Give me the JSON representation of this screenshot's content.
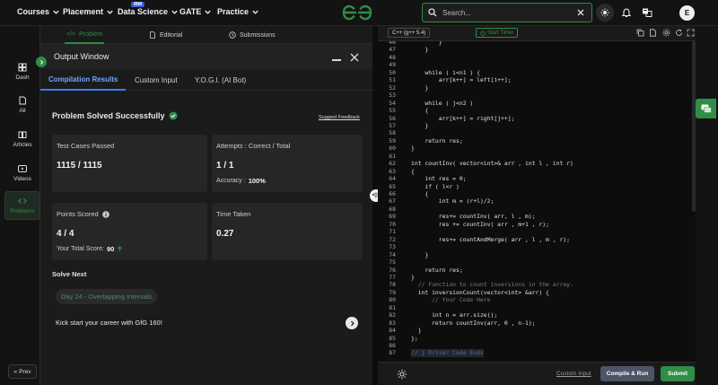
{
  "nav": {
    "items": [
      {
        "label": "Courses"
      },
      {
        "label": "Placement"
      },
      {
        "label": "Data Science"
      },
      {
        "label": "GATE"
      },
      {
        "label": "Practice"
      }
    ],
    "ibm_badge": "IBM",
    "search_placeholder": "Search...",
    "avatar_initial": "E"
  },
  "sidebar": {
    "items": [
      {
        "label": "Dash"
      },
      {
        "label": "All"
      },
      {
        "label": "Articles"
      },
      {
        "label": "Videos"
      },
      {
        "label": "Problems"
      }
    ],
    "prev_label": "Prev"
  },
  "problem_tabs": [
    {
      "label": "Problem"
    },
    {
      "label": "Editorial"
    },
    {
      "label": "Submissions"
    }
  ],
  "output": {
    "title": "Output Window",
    "tabs": [
      {
        "label": "Compilation Results"
      },
      {
        "label": "Custom Input"
      },
      {
        "label": "Y.O.G.I. (AI Bot)"
      }
    ],
    "status": "Problem Solved Successfully",
    "feedback": "Suggest Feedback",
    "cards": {
      "tests": {
        "label": "Test Cases Passed",
        "value": "1115 / 1115"
      },
      "attempts": {
        "label": "Attempts : Correct / Total",
        "value": "1 / 1",
        "sub_label": "Accuracy :",
        "sub_value": "100%"
      },
      "points": {
        "label": "Points Scored",
        "value": "4 / 4",
        "sub_label": "Your Total Score:",
        "sub_value": "90"
      },
      "time": {
        "label": "Time Taken",
        "value": "0.27"
      }
    },
    "solve_next": "Solve Next",
    "next_problem": "Day 24 - Overlapping Intervals",
    "kickstart": "Kick start your career with GfG 160!"
  },
  "editor": {
    "language": "C++ (g++ 5.4)",
    "timer": "Start Timer",
    "lines": [
      {
        "n": "46",
        "t": "        }"
      },
      {
        "n": "47",
        "t": "    }"
      },
      {
        "n": "48",
        "t": ""
      },
      {
        "n": "49",
        "t": ""
      },
      {
        "n": "50",
        "t": "    while ( i<n1 ) {"
      },
      {
        "n": "51",
        "t": "        arr[k++] = left[i++];"
      },
      {
        "n": "52",
        "t": "    }"
      },
      {
        "n": "53",
        "t": ""
      },
      {
        "n": "54",
        "t": "    while ( j<n2 )"
      },
      {
        "n": "55",
        "t": "    {"
      },
      {
        "n": "56",
        "t": "        arr[k++] = right[j++];"
      },
      {
        "n": "57",
        "t": "    }"
      },
      {
        "n": "58",
        "t": ""
      },
      {
        "n": "59",
        "t": "    return res;"
      },
      {
        "n": "60",
        "t": "}"
      },
      {
        "n": "61",
        "t": ""
      },
      {
        "n": "62",
        "t": "int countInv( vector<int>& arr , int l , int r)"
      },
      {
        "n": "63",
        "t": "{"
      },
      {
        "n": "64",
        "t": "    int res = 0;"
      },
      {
        "n": "65",
        "t": "    if ( l<r )"
      },
      {
        "n": "66",
        "t": "    {"
      },
      {
        "n": "67",
        "t": "        int m = (r+l)/2;"
      },
      {
        "n": "68",
        "t": ""
      },
      {
        "n": "69",
        "t": "        res+= countInv( arr, l , m);"
      },
      {
        "n": "70",
        "t": "        res += countInv( arr , m+1 , r);"
      },
      {
        "n": "71",
        "t": ""
      },
      {
        "n": "72",
        "t": "        res+= countAndMerge( arr , l , m , r);"
      },
      {
        "n": "73",
        "t": ""
      },
      {
        "n": "74",
        "t": "    }"
      },
      {
        "n": "75",
        "t": ""
      },
      {
        "n": "76",
        "t": "    return res;"
      },
      {
        "n": "77",
        "t": "}"
      },
      {
        "n": "78",
        "t": "  // Function to count inversions in the array."
      },
      {
        "n": "79",
        "t": "  int inversionCount(vector<int> &arr) {"
      },
      {
        "n": "80",
        "t": "      // Your Code Here"
      },
      {
        "n": "81",
        "t": ""
      },
      {
        "n": "82",
        "t": "      int n = arr.size();"
      },
      {
        "n": "83",
        "t": "      return countInv(arr, 0 , n-1);"
      },
      {
        "n": "84",
        "t": "  }"
      },
      {
        "n": "85",
        "t": "};"
      },
      {
        "n": "86",
        "t": ""
      },
      {
        "n": "87",
        "t": "// } Driver Code Ends"
      }
    ],
    "custom_input": "Custom Input",
    "compile": "Compile & Run",
    "submit": "Submit"
  },
  "colors": {
    "accent_green": "#2f8d46",
    "accent_blue": "#3b7bf0",
    "background": "#131313"
  }
}
